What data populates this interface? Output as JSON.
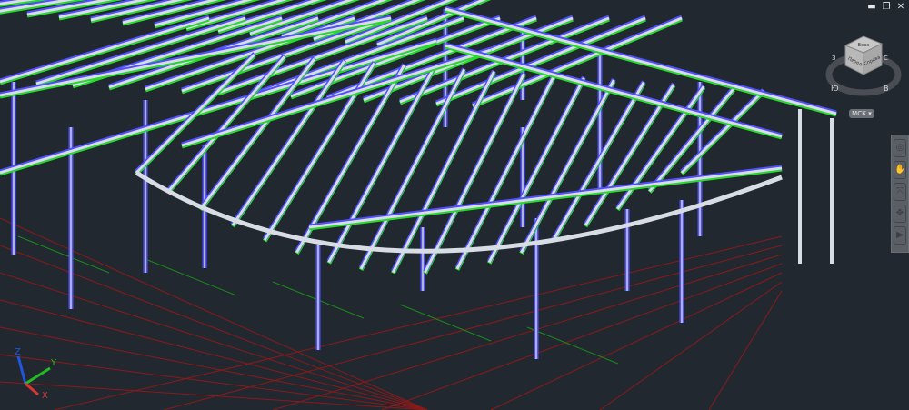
{
  "window_controls": {
    "minimize": "▬",
    "restore": "❐",
    "close": "✕"
  },
  "viewcube": {
    "top": "Верх",
    "front": "Перед",
    "right": "Справа",
    "compass": {
      "west": "З",
      "south": "Ю",
      "east": "В",
      "north": "С"
    }
  },
  "ucs_menu": {
    "label": "МСК ▾"
  },
  "navbar": {
    "items": [
      "full-navigation-wheel",
      "pan",
      "zoom",
      "orbit",
      "showmotion"
    ]
  },
  "ucs_icon": {
    "x": "X",
    "y": "Y",
    "z": "Z"
  },
  "colors": {
    "background": "#212830",
    "beam": "#d8dce4",
    "outline_green": "#22dd22",
    "outline_blue": "#5050ff",
    "grid_red": "#8a1a1a",
    "grid_green": "#1a8a1a"
  }
}
